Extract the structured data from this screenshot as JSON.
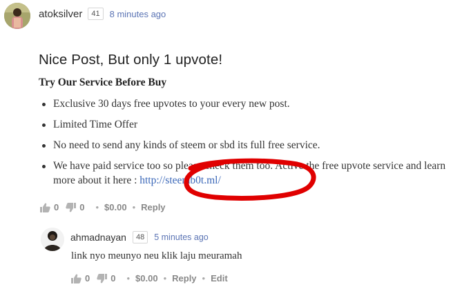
{
  "main_comment": {
    "author": "atoksilver",
    "reputation": "41",
    "time": "8 minutes ago",
    "headline": "Nice Post, But only 1 upvote!",
    "subheading": "Try Our Service Before Buy",
    "bullets": [
      "Exclusive 30 days free upvotes to your every new post.",
      "Limited Time Offer",
      "No need to send any kinds of steem or sbd its full free service."
    ],
    "last_bullet_text": "We have paid service too so please check them too. Active the free upvote service and learn more about it here : ",
    "link_text": "http://steemb0t.ml/",
    "actions": {
      "upvotes": "0",
      "downvotes": "0",
      "payout": "$0.00",
      "reply_label": "Reply"
    },
    "annotation_color": "#e00000"
  },
  "reply_comment": {
    "author": "ahmadnayan",
    "reputation": "48",
    "time": "5 minutes ago",
    "body": "link nyo meunyo neu klik laju meuramah",
    "actions": {
      "upvotes": "0",
      "downvotes": "0",
      "payout": "$0.00",
      "reply_label": "Reply",
      "edit_label": "Edit"
    }
  },
  "icons": {
    "upvote": "thumbs-up-icon",
    "downvote": "thumbs-down-icon"
  }
}
